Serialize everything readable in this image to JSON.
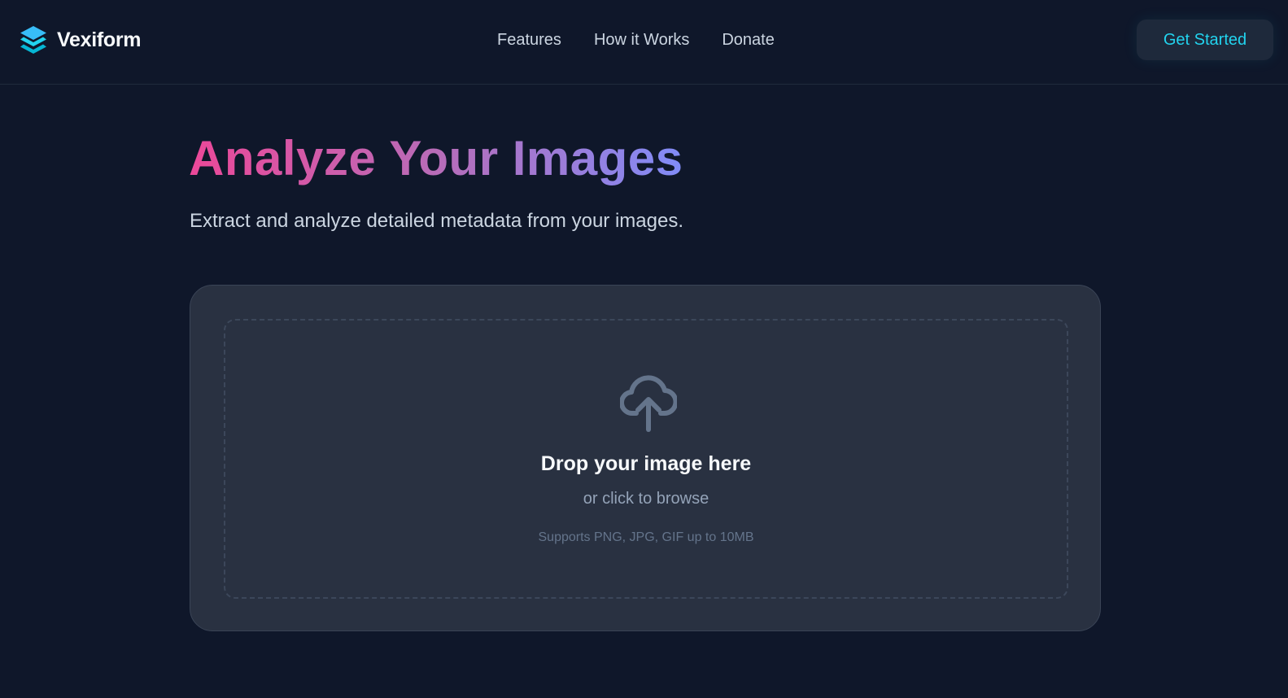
{
  "navbar": {
    "brand_name": "Vexiform",
    "brand_icon": "stacked-layers-icon",
    "links": [
      {
        "label": "Features"
      },
      {
        "label": "How it Works"
      },
      {
        "label": "Donate"
      }
    ],
    "cta_label": "Get Started"
  },
  "hero": {
    "title": "Analyze Your Images",
    "subtitle": "Extract and analyze detailed metadata from your images."
  },
  "upload": {
    "icon": "cloud-upload-icon",
    "title": "Drop your image here",
    "subtitle": "or click to browse",
    "note": "Supports PNG, JPG, GIF up to 10MB"
  },
  "colors": {
    "background": "#0f172a",
    "card": "#293141",
    "accent": "#22d3ee",
    "gradient_start": "#ec4899",
    "gradient_end": "#818cf8"
  }
}
